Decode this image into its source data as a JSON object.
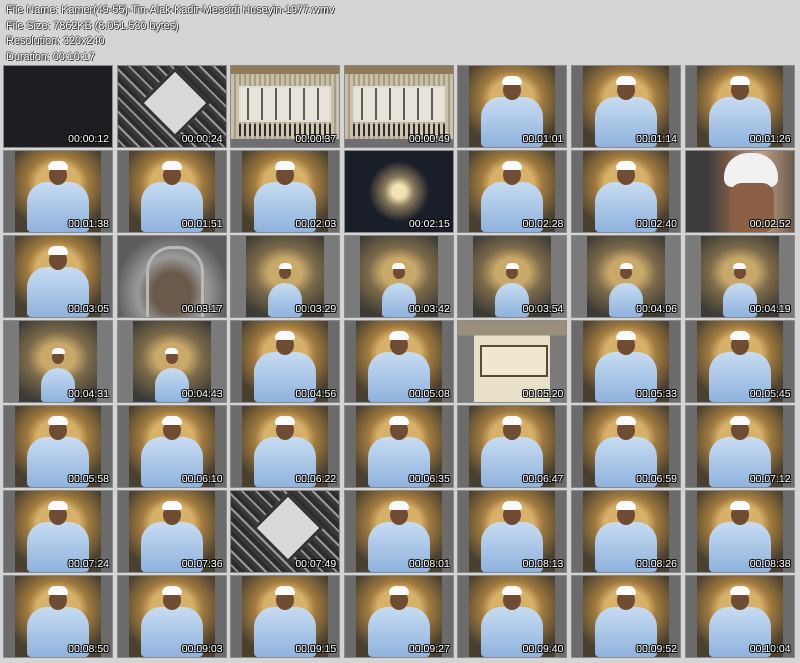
{
  "header": {
    "file_name": "File Name: Kamer(49-55)-Tin-Alak-Kadir-Mescidi Huseyin-1977.wmv",
    "file_size": "File Size: 7862KB (8.051.530 bytes)",
    "resolution": "Resolution: 320x240",
    "duration": "Duration: 00:10:17"
  },
  "thumbnails": [
    {
      "time": "00:00:12",
      "scene": "black"
    },
    {
      "time": "00:00:24",
      "scene": "pattern"
    },
    {
      "time": "00:00:37",
      "scene": "calligraphy"
    },
    {
      "time": "00:00:49",
      "scene": "calligraphy"
    },
    {
      "time": "00:01:01",
      "scene": "sitter"
    },
    {
      "time": "00:01:14",
      "scene": "sitter"
    },
    {
      "time": "00:01:26",
      "scene": "sitter"
    },
    {
      "time": "00:01:38",
      "scene": "sitter"
    },
    {
      "time": "00:01:51",
      "scene": "sitter"
    },
    {
      "time": "00:02:03",
      "scene": "sitter"
    },
    {
      "time": "00:02:15",
      "scene": "chandelier"
    },
    {
      "time": "00:02:28",
      "scene": "sitter"
    },
    {
      "time": "00:02:40",
      "scene": "sitter"
    },
    {
      "time": "00:02:52",
      "scene": "closeup"
    },
    {
      "time": "00:03:05",
      "scene": "sitter"
    },
    {
      "time": "00:03:17",
      "scene": "mihrab"
    },
    {
      "time": "00:03:29",
      "scene": "sitter-wide"
    },
    {
      "time": "00:03:42",
      "scene": "sitter-wide"
    },
    {
      "time": "00:03:54",
      "scene": "sitter-wide"
    },
    {
      "time": "00:04:06",
      "scene": "sitter-wide"
    },
    {
      "time": "00:04:19",
      "scene": "sitter-wide"
    },
    {
      "time": "00:04:31",
      "scene": "sitter-wide"
    },
    {
      "time": "00:04:43",
      "scene": "sitter-wide"
    },
    {
      "time": "00:04:56",
      "scene": "sitter"
    },
    {
      "time": "00:05:08",
      "scene": "sitter"
    },
    {
      "time": "00:05:20",
      "scene": "sign"
    },
    {
      "time": "00:05:33",
      "scene": "sitter"
    },
    {
      "time": "00:05:45",
      "scene": "sitter"
    },
    {
      "time": "00:05:58",
      "scene": "sitter"
    },
    {
      "time": "00:06:10",
      "scene": "sitter"
    },
    {
      "time": "00:06:22",
      "scene": "sitter"
    },
    {
      "time": "00:06:35",
      "scene": "sitter"
    },
    {
      "time": "00:06:47",
      "scene": "sitter"
    },
    {
      "time": "00:06:59",
      "scene": "sitter"
    },
    {
      "time": "00:07:12",
      "scene": "sitter"
    },
    {
      "time": "00:07:24",
      "scene": "sitter"
    },
    {
      "time": "00:07:36",
      "scene": "sitter"
    },
    {
      "time": "00:07:49",
      "scene": "pattern"
    },
    {
      "time": "00:08:01",
      "scene": "sitter"
    },
    {
      "time": "00:08:13",
      "scene": "sitter"
    },
    {
      "time": "00:08:26",
      "scene": "sitter"
    },
    {
      "time": "00:08:38",
      "scene": "sitter"
    },
    {
      "time": "00:08:50",
      "scene": "sitter"
    },
    {
      "time": "00:09:03",
      "scene": "sitter"
    },
    {
      "time": "00:09:15",
      "scene": "sitter"
    },
    {
      "time": "00:09:27",
      "scene": "sitter"
    },
    {
      "time": "00:09:40",
      "scene": "sitter"
    },
    {
      "time": "00:09:52",
      "scene": "sitter"
    },
    {
      "time": "00:10:04",
      "scene": "sitter"
    }
  ]
}
